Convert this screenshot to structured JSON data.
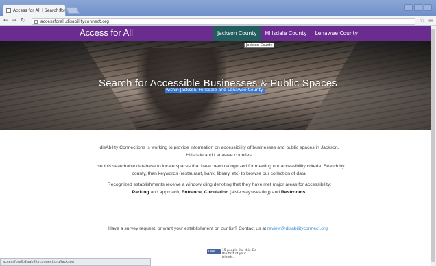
{
  "browser": {
    "tab_title": "Access for All | Search for",
    "tab_close": "×",
    "url": "accessforall.disabilityconnect.org",
    "status_url": "accessforall.disabilityconnect.org/jackson"
  },
  "site": {
    "brand": "Access for All",
    "nav": [
      {
        "label": "Jackson County",
        "active": true
      },
      {
        "label": "Hillsdale County",
        "active": false
      },
      {
        "label": "Lenawee County",
        "active": false
      }
    ],
    "tooltip": "Jackson County"
  },
  "hero": {
    "title": "Search for Accessible Businesses & Public Spaces",
    "subtitle": "within Jackson, Hillsdale and Lenawee County"
  },
  "content": {
    "p1": "disAbility Connections is working to provide information on accessibility  of businesses and public spaces in Jackson, Hillsdale and Lenawee counties.",
    "p2": "Use this searchable database to locate spaces that have been recognized for meeting our accessibility criteria.  Search by county, then keywords (restaurant, bank, library, etc) to browse our collection of data.",
    "p3_prefix": "Recognized establishments receive a window cling denoting that they have met major areas for accessibility:",
    "p3_parking": "Parking",
    "p3_and_approach": " and approach, ",
    "p3_entrance": "Entrance",
    "p3_comma": ", ",
    "p3_circulation": "Circulation",
    "p3_seating": " (aisle ways/seating) and ",
    "p3_restrooms": "Restrooms",
    "p3_end": ".",
    "contact_text": "Have a survey request, or want your establishment on our list?  Contact us at ",
    "contact_email": "review@disabilityconnect.org"
  },
  "facebook": {
    "button": "Like",
    "text": "15 people like this. Be the first of your friends."
  }
}
